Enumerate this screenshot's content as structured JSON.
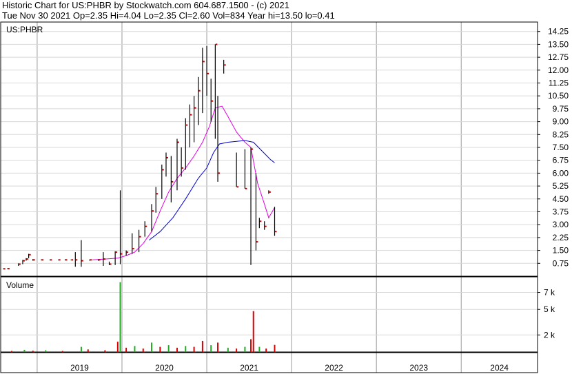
{
  "header": {
    "line1": "Historic Chart for US:PHBR by Stockwatch.com 604.687.1500 - (c) 2021",
    "line2": "Tue Nov 30 2021   Op=2.35   Hi=4.04   Lo=2.35   Cl=2.60   Vol=834   Year hi=13.50   lo=0.41"
  },
  "chart_data": [
    {
      "type": "line",
      "title": "US:PHBR",
      "ylim": [
        0,
        14.8
      ],
      "yticks": [
        "14.25",
        "13.50",
        "12.75",
        "12.00",
        "11.25",
        "10.50",
        "9.75",
        "9.00",
        "8.25",
        "7.50",
        "6.75",
        "6.00",
        "5.25",
        "4.50",
        "3.75",
        "3.00",
        "2.25",
        "1.50",
        "0.75"
      ],
      "ytick_values": [
        14.25,
        13.5,
        12.75,
        12.0,
        11.25,
        10.5,
        9.75,
        9.0,
        8.25,
        7.5,
        6.75,
        6.0,
        5.25,
        4.5,
        3.75,
        3.0,
        2.25,
        1.5,
        0.75
      ],
      "x_range": [
        2018.57,
        2024.9
      ],
      "year_labels": [
        "2019",
        "2020",
        "2021",
        "2022",
        "2023",
        "2024"
      ],
      "grid": true,
      "colors": {
        "hl_bar": "#000000",
        "close_tick": "#cc0000",
        "ma_short": "#e000e0",
        "ma_long": "#0000cc"
      },
      "price_bars": [
        {
          "x": 2018.6,
          "h": 0.45,
          "l": 0.41,
          "c": 0.43
        },
        {
          "x": 2018.65,
          "h": 0.46,
          "l": 0.42,
          "c": 0.44
        },
        {
          "x": 2018.78,
          "h": 0.75,
          "l": 0.6,
          "c": 0.7
        },
        {
          "x": 2018.83,
          "h": 0.95,
          "l": 0.7,
          "c": 0.9
        },
        {
          "x": 2018.87,
          "h": 1.05,
          "l": 0.9,
          "c": 1.0
        },
        {
          "x": 2018.9,
          "h": 1.3,
          "l": 1.05,
          "c": 1.25
        },
        {
          "x": 2018.95,
          "h": 1.0,
          "l": 0.9,
          "c": 0.95
        },
        {
          "x": 2019.05,
          "h": 0.98,
          "l": 0.92,
          "c": 0.95
        },
        {
          "x": 2019.15,
          "h": 0.97,
          "l": 0.93,
          "c": 0.95
        },
        {
          "x": 2019.25,
          "h": 0.97,
          "l": 0.93,
          "c": 0.95
        },
        {
          "x": 2019.33,
          "h": 0.98,
          "l": 0.92,
          "c": 0.95
        },
        {
          "x": 2019.4,
          "h": 0.97,
          "l": 0.93,
          "c": 0.95
        },
        {
          "x": 2019.45,
          "h": 1.4,
          "l": 0.55,
          "c": 0.95
        },
        {
          "x": 2019.52,
          "h": 2.1,
          "l": 0.55,
          "c": 0.9
        },
        {
          "x": 2019.62,
          "h": 0.98,
          "l": 0.9,
          "c": 0.95
        },
        {
          "x": 2019.72,
          "h": 0.98,
          "l": 0.9,
          "c": 0.95
        },
        {
          "x": 2019.78,
          "h": 1.4,
          "l": 0.6,
          "c": 1.0
        },
        {
          "x": 2019.85,
          "h": 0.85,
          "l": 0.65,
          "c": 0.7
        },
        {
          "x": 2019.92,
          "h": 1.45,
          "l": 0.65,
          "c": 1.4
        },
        {
          "x": 2019.98,
          "h": 5.0,
          "l": 0.7,
          "c": 1.3
        },
        {
          "x": 2020.05,
          "h": 1.5,
          "l": 1.2,
          "c": 1.4
        },
        {
          "x": 2020.12,
          "h": 2.5,
          "l": 1.3,
          "c": 1.6
        },
        {
          "x": 2020.2,
          "h": 2.7,
          "l": 1.4,
          "c": 2.3
        },
        {
          "x": 2020.27,
          "h": 3.2,
          "l": 2.3,
          "c": 2.9
        },
        {
          "x": 2020.35,
          "h": 4.2,
          "l": 2.6,
          "c": 3.8
        },
        {
          "x": 2020.4,
          "h": 5.2,
          "l": 3.7,
          "c": 4.8
        },
        {
          "x": 2020.47,
          "h": 6.5,
          "l": 4.5,
          "c": 6.2
        },
        {
          "x": 2020.52,
          "h": 7.2,
          "l": 5.8,
          "c": 6.9
        },
        {
          "x": 2020.58,
          "h": 7.0,
          "l": 4.3,
          "c": 5.5
        },
        {
          "x": 2020.65,
          "h": 8.0,
          "l": 5.0,
          "c": 7.8
        },
        {
          "x": 2020.7,
          "h": 7.5,
          "l": 5.8,
          "c": 6.3
        },
        {
          "x": 2020.75,
          "h": 9.2,
          "l": 6.2,
          "c": 8.8
        },
        {
          "x": 2020.8,
          "h": 10.0,
          "l": 7.5,
          "c": 9.4
        },
        {
          "x": 2020.85,
          "h": 10.5,
          "l": 7.8,
          "c": 9.8
        },
        {
          "x": 2020.9,
          "h": 11.6,
          "l": 8.8,
          "c": 10.8
        },
        {
          "x": 2020.95,
          "h": 13.3,
          "l": 9.5,
          "c": 12.5
        },
        {
          "x": 2021.0,
          "h": 13.4,
          "l": 10.5,
          "c": 11.8
        },
        {
          "x": 2021.05,
          "h": 11.5,
          "l": 9.0,
          "c": 10.2
        },
        {
          "x": 2021.1,
          "h": 13.5,
          "l": 8.0,
          "c": 13.5
        },
        {
          "x": 2021.13,
          "h": 10.5,
          "l": 5.5,
          "c": 6.0
        },
        {
          "x": 2021.2,
          "h": 12.6,
          "l": 11.8,
          "c": 12.3
        },
        {
          "x": 2021.35,
          "h": 7.2,
          "l": 5.2,
          "c": 5.2
        },
        {
          "x": 2021.45,
          "h": 7.4,
          "l": 5.1,
          "c": 5.1
        },
        {
          "x": 2021.52,
          "h": 7.5,
          "l": 0.65,
          "c": 7.4
        },
        {
          "x": 2021.58,
          "h": 6.0,
          "l": 1.5,
          "c": 2.0
        },
        {
          "x": 2021.62,
          "h": 3.4,
          "l": 2.8,
          "c": 3.2
        },
        {
          "x": 2021.68,
          "h": 3.2,
          "l": 2.7,
          "c": 2.9
        },
        {
          "x": 2021.73,
          "h": 5.0,
          "l": 4.8,
          "c": 4.9
        },
        {
          "x": 2021.8,
          "h": 4.04,
          "l": 2.35,
          "c": 2.6
        }
      ],
      "ma_short": [
        {
          "x": 2019.65,
          "y": 0.95
        },
        {
          "x": 2019.8,
          "y": 1.0
        },
        {
          "x": 2019.95,
          "y": 1.05
        },
        {
          "x": 2020.05,
          "y": 1.2
        },
        {
          "x": 2020.15,
          "y": 1.4
        },
        {
          "x": 2020.25,
          "y": 1.9
        },
        {
          "x": 2020.35,
          "y": 2.6
        },
        {
          "x": 2020.45,
          "y": 3.8
        },
        {
          "x": 2020.55,
          "y": 4.9
        },
        {
          "x": 2020.65,
          "y": 5.7
        },
        {
          "x": 2020.75,
          "y": 6.3
        },
        {
          "x": 2020.85,
          "y": 7.0
        },
        {
          "x": 2020.95,
          "y": 7.8
        },
        {
          "x": 2021.03,
          "y": 8.7
        },
        {
          "x": 2021.1,
          "y": 9.8
        },
        {
          "x": 2021.18,
          "y": 9.9
        },
        {
          "x": 2021.25,
          "y": 9.3
        },
        {
          "x": 2021.35,
          "y": 8.4
        },
        {
          "x": 2021.45,
          "y": 7.8
        },
        {
          "x": 2021.52,
          "y": 7.5
        },
        {
          "x": 2021.6,
          "y": 5.4
        },
        {
          "x": 2021.68,
          "y": 4.2
        },
        {
          "x": 2021.73,
          "y": 3.4
        },
        {
          "x": 2021.8,
          "y": 4.0
        }
      ],
      "ma_long": [
        {
          "x": 2020.32,
          "y": 2.1
        },
        {
          "x": 2020.45,
          "y": 2.6
        },
        {
          "x": 2020.6,
          "y": 3.4
        },
        {
          "x": 2020.75,
          "y": 4.5
        },
        {
          "x": 2020.9,
          "y": 5.7
        },
        {
          "x": 2021.0,
          "y": 6.3
        },
        {
          "x": 2021.08,
          "y": 7.2
        },
        {
          "x": 2021.15,
          "y": 7.7
        },
        {
          "x": 2021.25,
          "y": 7.8
        },
        {
          "x": 2021.35,
          "y": 7.85
        },
        {
          "x": 2021.45,
          "y": 7.9
        },
        {
          "x": 2021.55,
          "y": 7.8
        },
        {
          "x": 2021.65,
          "y": 7.3
        },
        {
          "x": 2021.75,
          "y": 6.8
        },
        {
          "x": 2021.8,
          "y": 6.6
        }
      ]
    },
    {
      "type": "bar",
      "title": "Volume",
      "ylim": [
        0,
        8500
      ],
      "yticks": [
        "7 k",
        "5 k",
        "2 k"
      ],
      "ytick_values": [
        7000,
        5000,
        2000
      ],
      "bars": [
        {
          "x": 2018.7,
          "v": 120,
          "c": "red"
        },
        {
          "x": 2018.85,
          "v": 250,
          "c": "green"
        },
        {
          "x": 2018.95,
          "v": 150,
          "c": "red"
        },
        {
          "x": 2019.1,
          "v": 200,
          "c": "green"
        },
        {
          "x": 2019.3,
          "v": 120,
          "c": "red"
        },
        {
          "x": 2019.52,
          "v": 600,
          "c": "green"
        },
        {
          "x": 2019.6,
          "v": 300,
          "c": "red"
        },
        {
          "x": 2019.8,
          "v": 200,
          "c": "red"
        },
        {
          "x": 2019.95,
          "v": 1200,
          "c": "red"
        },
        {
          "x": 2019.98,
          "v": 8200,
          "c": "green"
        },
        {
          "x": 2020.05,
          "v": 500,
          "c": "red"
        },
        {
          "x": 2020.15,
          "v": 700,
          "c": "green"
        },
        {
          "x": 2020.25,
          "v": 400,
          "c": "red"
        },
        {
          "x": 2020.35,
          "v": 1100,
          "c": "green"
        },
        {
          "x": 2020.45,
          "v": 600,
          "c": "red"
        },
        {
          "x": 2020.55,
          "v": 800,
          "c": "green"
        },
        {
          "x": 2020.65,
          "v": 500,
          "c": "red"
        },
        {
          "x": 2020.75,
          "v": 700,
          "c": "green"
        },
        {
          "x": 2020.85,
          "v": 600,
          "c": "red"
        },
        {
          "x": 2020.95,
          "v": 1300,
          "c": "red"
        },
        {
          "x": 2021.05,
          "v": 800,
          "c": "green"
        },
        {
          "x": 2021.13,
          "v": 1100,
          "c": "red"
        },
        {
          "x": 2021.25,
          "v": 500,
          "c": "green"
        },
        {
          "x": 2021.35,
          "v": 400,
          "c": "red"
        },
        {
          "x": 2021.45,
          "v": 600,
          "c": "green"
        },
        {
          "x": 2021.52,
          "v": 1500,
          "c": "red"
        },
        {
          "x": 2021.55,
          "v": 4800,
          "c": "red"
        },
        {
          "x": 2021.62,
          "v": 600,
          "c": "green"
        },
        {
          "x": 2021.7,
          "v": 400,
          "c": "red"
        },
        {
          "x": 2021.8,
          "v": 834,
          "c": "red"
        }
      ]
    }
  ]
}
